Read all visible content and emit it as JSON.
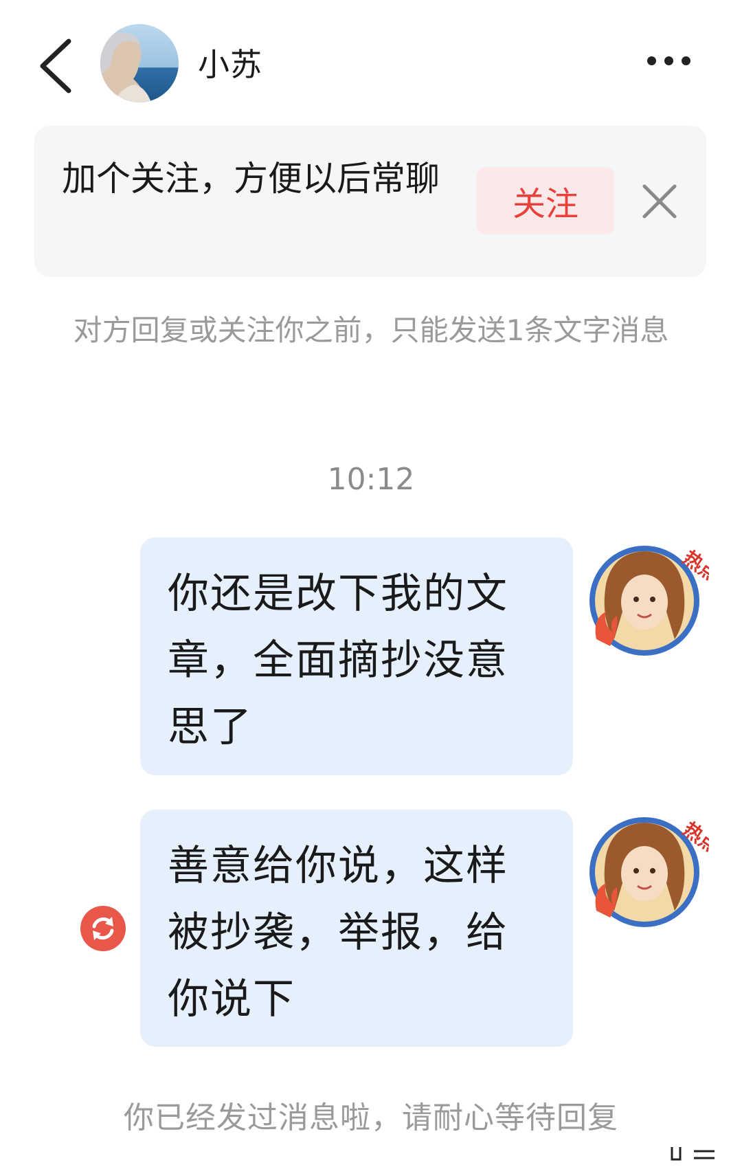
{
  "header": {
    "contact_name": "小苏",
    "back_icon": "chevron-left-icon",
    "more_icon": "more-horizontal-icon"
  },
  "follow_banner": {
    "text": "加个关注，方便以后常聊",
    "follow_label": "关注",
    "close_icon": "close-icon"
  },
  "notice": {
    "text": "对方回复或关注你之前，只能发送1条文字消息"
  },
  "timestamp": "10:12",
  "messages": [
    {
      "text": "你还是改下我的文章，全面摘抄没意思了",
      "sender": "me"
    },
    {
      "text": "善意给你说，这样被抄袭，举报，给你说下",
      "sender": "me",
      "status_icon": "resend-icon"
    }
  ],
  "avatar_badge": "热点侠",
  "bottom_status": "你已经发过消息啦，请耐心等待回复",
  "colors": {
    "accent_red": "#e8403a",
    "bubble_bg": "#e6f0fc",
    "banner_bg": "#f5f6f8",
    "muted_text": "#9a9a9a",
    "follow_btn_bg": "#fbe8e8"
  }
}
